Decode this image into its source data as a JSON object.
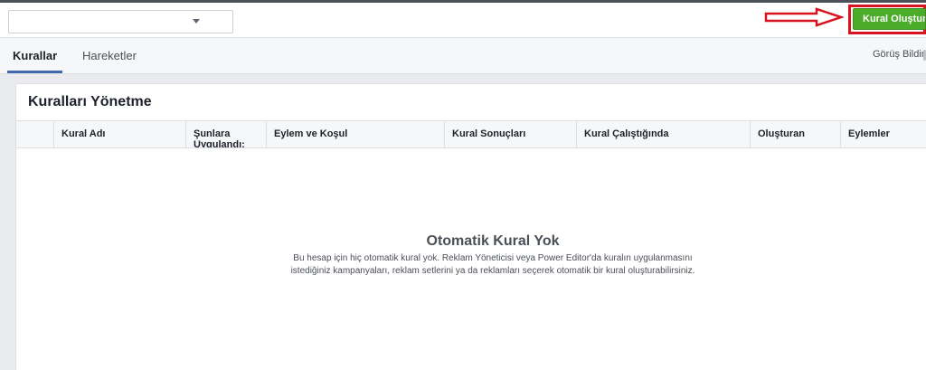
{
  "header": {
    "account_select_value": "",
    "create_rule_label": "Kural Oluştur"
  },
  "tabs": [
    {
      "label": "Kurallar",
      "active": true
    },
    {
      "label": "Hareketler",
      "active": false
    }
  ],
  "feedback_label": "Görüş Bildir",
  "panel": {
    "title": "Kuralları Yönetme",
    "columns": [
      "Kural Adı",
      "Şunlara Uygulandı:",
      "Eylem ve Koşul",
      "Kural Sonuçları",
      "Kural Çalıştığında",
      "Oluşturan",
      "Eylemler"
    ],
    "rows": []
  },
  "empty_state": {
    "title": "Otomatik Kural Yok",
    "description": "Bu hesap için hiç otomatik kural yok. Reklam Yöneticisi veya Power Editor'da kuralın uygulanmasını istediğiniz kampanyaları, reklam setlerini ya da reklamları seçerek otomatik bir kural oluşturabilirsiniz."
  },
  "colors": {
    "create_button": "#4bac2a",
    "annotation_red": "#d8121f",
    "active_tab_underline": "#4267b2"
  }
}
